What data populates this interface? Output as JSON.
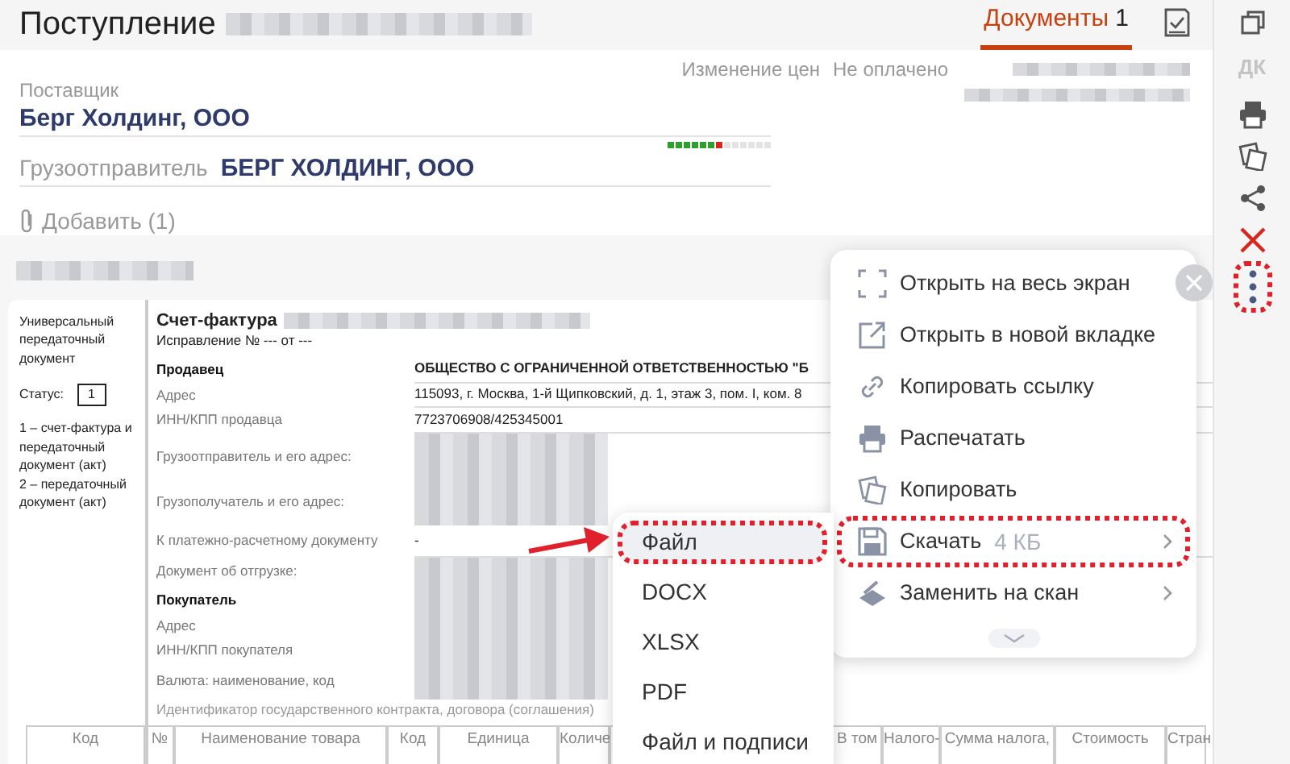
{
  "header": {
    "title": "Поступление",
    "tabs": [
      {
        "label": "Документы",
        "count": "1",
        "selected": true
      }
    ]
  },
  "status_tags": [
    "Изменение цен",
    "Не оплачено"
  ],
  "supplier": {
    "label": "Поставщик",
    "value": "Берг Холдинг, ООО",
    "segments": [
      {
        "color": "#2e9e2e"
      },
      {
        "color": "#2e9e2e"
      },
      {
        "color": "#2e9e2e"
      },
      {
        "color": "#2e9e2e"
      },
      {
        "color": "#2e9e2e"
      },
      {
        "color": "#2e9e2e"
      },
      {
        "color": "#d9261c"
      },
      {
        "color": "#e3e3e3"
      },
      {
        "color": "#e3e3e3"
      },
      {
        "color": "#e3e3e3"
      },
      {
        "color": "#e3e3e3"
      },
      {
        "color": "#e3e3e3"
      },
      {
        "color": "#e3e3e3"
      }
    ]
  },
  "shipper": {
    "label": "Грузоотправитель",
    "value": "БЕРГ ХОЛДИНГ, ООО"
  },
  "attachments": {
    "label": "Добавить (1)"
  },
  "document": {
    "type_label": "Универсальный передаточный документ",
    "status_label": "Статус:",
    "status_value": "1",
    "status_legend": [
      "1 – счет-фактура и передаточный документ (акт)",
      "2 – передаточный документ (акт)"
    ],
    "title": "Счет-фактура",
    "correction": "Исправление № --- от ---",
    "rows": [
      {
        "kind": "section",
        "label": "Продавец",
        "value": "ОБЩЕСТВО С ОГРАНИЧЕННОЙ ОТВЕТСТВЕННОСТЬЮ \"Б"
      },
      {
        "kind": "field",
        "label": "Адрес",
        "value": "115093, г. Москва, 1-й Щипковский, д. 1, этаж 3, пом. I, ком. 8"
      },
      {
        "kind": "field",
        "label": "ИНН/КПП продавца",
        "value": "7723706908/425345001"
      },
      {
        "kind": "redacted",
        "label": "Грузоотправитель и его адрес:"
      },
      {
        "kind": "redacted",
        "label": "Грузополучатель и его адрес:"
      },
      {
        "kind": "field",
        "label": "К платежно-расчетному документу",
        "value": "-"
      },
      {
        "kind": "redacted",
        "label": "Документ об отгрузке:"
      },
      {
        "kind": "section-redacted",
        "label": "Покупатель"
      },
      {
        "kind": "redacted",
        "label": "Адрес"
      },
      {
        "kind": "redacted",
        "label": "ИНН/КПП покупателя"
      },
      {
        "kind": "redacted",
        "label": "Валюта: наименование, код"
      },
      {
        "kind": "wide",
        "label": "Идентификатор государственного контракта, договора (соглашения)"
      }
    ],
    "table_columns": [
      "Код",
      "№",
      "Наименование товара",
      "Код",
      "Единица",
      "Количе",
      "",
      "В том",
      "Налого-",
      "Сумма налога,",
      "Стоимость",
      "Стран"
    ]
  },
  "toolbar": {
    "dk": {
      "label": "ДК",
      "disabled": true
    },
    "more": {
      "highlighted": true
    }
  },
  "menu": {
    "items": [
      {
        "label": "Открыть на весь экран",
        "submenu": false,
        "highlighted": false
      },
      {
        "label": "Открыть в новой вкладке",
        "submenu": false,
        "highlighted": false
      },
      {
        "label": "Копировать ссылку",
        "submenu": false,
        "highlighted": false
      },
      {
        "label": "Распечатать",
        "submenu": false,
        "highlighted": false
      },
      {
        "label": "Копировать",
        "submenu": false,
        "highlighted": false
      },
      {
        "label": "Скачать",
        "size": "4 КБ",
        "submenu": true,
        "highlighted": true
      },
      {
        "label": "Заменить на скан",
        "submenu": true,
        "highlighted": false
      }
    ]
  },
  "submenu": {
    "items": [
      {
        "label": "Файл",
        "highlighted": true
      },
      {
        "label": "DOCX",
        "highlighted": false
      },
      {
        "label": "XLSX",
        "highlighted": false
      },
      {
        "label": "PDF",
        "highlighted": false
      },
      {
        "label": "Файл и подписи",
        "highlighted": false
      }
    ]
  }
}
